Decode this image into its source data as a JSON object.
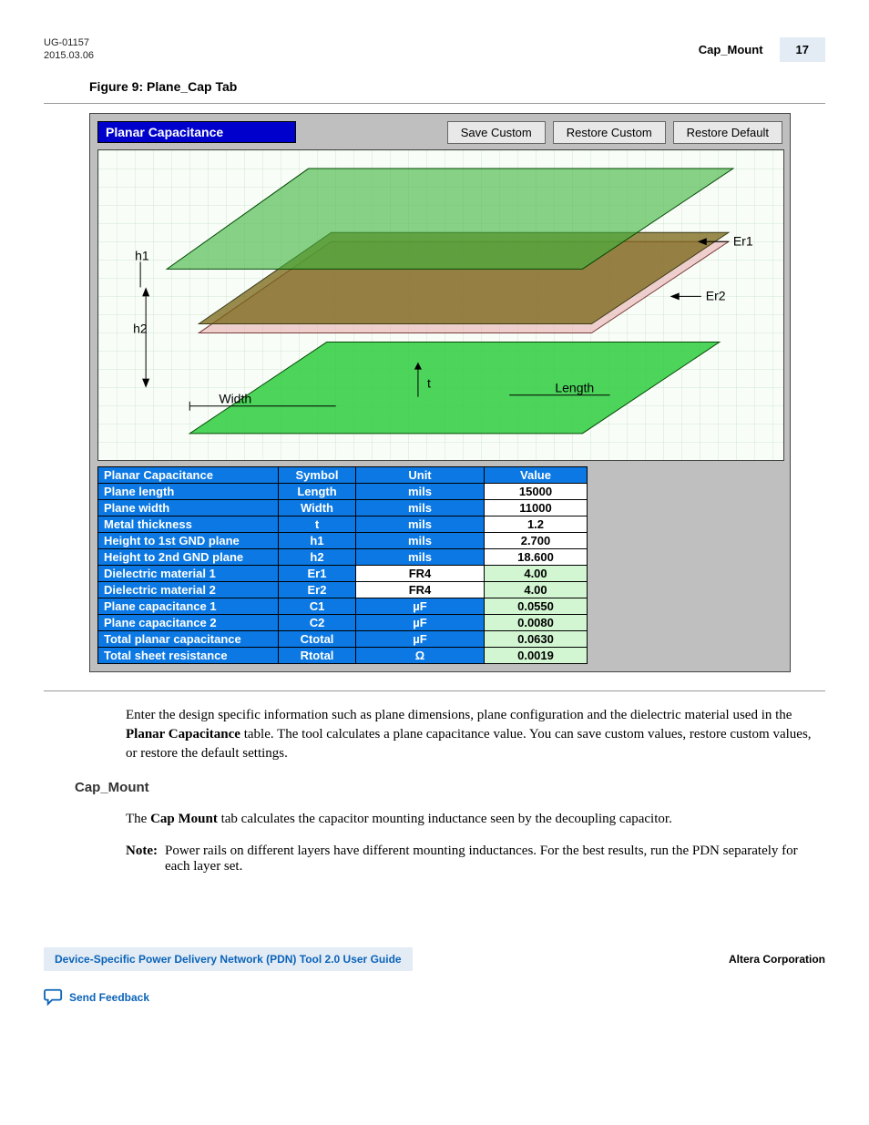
{
  "header": {
    "doc_id": "UG-01157",
    "date": "2015.03.06",
    "section": "Cap_Mount",
    "page": "17"
  },
  "figure": {
    "caption": "Figure 9: Plane_Cap Tab"
  },
  "window": {
    "title": "Planar Capacitance",
    "buttons": {
      "save": "Save Custom",
      "restore_custom": "Restore Custom",
      "restore_default": "Restore Default"
    },
    "diagram_labels": {
      "h1": "h1",
      "h2": "h2",
      "t": "t",
      "width": "Width",
      "length": "Length",
      "er1": "Er1",
      "er2": "Er2"
    },
    "table": {
      "head": [
        "Planar Capacitance",
        "Symbol",
        "Unit",
        "Value"
      ],
      "rows": [
        {
          "label": "Plane length",
          "symbol": "Length",
          "unit": "mils",
          "value": "15000",
          "kind": "input"
        },
        {
          "label": "Plane width",
          "symbol": "Width",
          "unit": "mils",
          "value": "11000",
          "kind": "input"
        },
        {
          "label": "Metal thickness",
          "symbol": "t",
          "unit": "mils",
          "value": "1.2",
          "kind": "input"
        },
        {
          "label": "Height to 1st GND plane",
          "symbol": "h1",
          "unit": "mils",
          "value": "2.700",
          "kind": "input"
        },
        {
          "label": "Height to 2nd GND plane",
          "symbol": "h2",
          "unit": "mils",
          "value": "18.600",
          "kind": "input"
        },
        {
          "label": "Dielectric material 1",
          "symbol": "Er1",
          "unit": "FR4",
          "unit_style": "white",
          "value": "4.00",
          "kind": "calc"
        },
        {
          "label": "Dielectric material 2",
          "symbol": "Er2",
          "unit": "FR4",
          "unit_style": "white",
          "value": "4.00",
          "kind": "calc"
        },
        {
          "label": "Plane capacitance 1",
          "symbol": "C1",
          "unit": "µF",
          "value": "0.0550",
          "kind": "calc"
        },
        {
          "label": "Plane capacitance 2",
          "symbol": "C2",
          "unit": "µF",
          "value": "0.0080",
          "kind": "calc"
        },
        {
          "label": "Total planar capacitance",
          "symbol": "Ctotal",
          "unit": "µF",
          "value": "0.0630",
          "kind": "calc"
        },
        {
          "label": "Total sheet resistance",
          "symbol": "Rtotal",
          "unit": "Ω",
          "value": "0.0019",
          "kind": "calc"
        }
      ]
    }
  },
  "content": {
    "intro_1a": "Enter the design specific information such as plane dimensions, plane configuration and the dielectric material used in the ",
    "intro_bold": "Planar Capacitance",
    "intro_1b": " table. The tool calculates a plane capacitance value. You can save custom values, restore custom values, or restore the default settings.",
    "section_head": "Cap_Mount",
    "para2a": "The ",
    "para2bold": "Cap Mount",
    "para2b": " tab calculates the capacitor mounting inductance seen by the decoupling capacitor.",
    "note_label": "Note:",
    "note_text": "Power rails on different layers have different mounting inductances. For the best results, run the PDN separately for each layer set."
  },
  "footer": {
    "guide": "Device-Specific Power Delivery Network (PDN) Tool 2.0 User Guide",
    "company": "Altera Corporation",
    "feedback": "Send Feedback"
  }
}
